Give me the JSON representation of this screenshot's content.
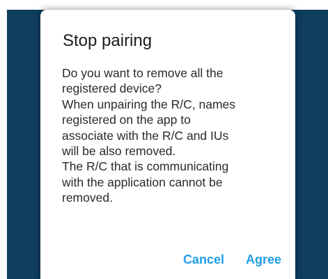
{
  "dialog": {
    "title": "Stop pairing",
    "body_lines": [
      "Do you want to remove all the",
      "registered device?",
      "When unpairing the R/C, names",
      "registered on the app to",
      "associate with the R/C and IUs",
      "will be also removed.",
      "The R/C that is communicating",
      "with the application cannot be",
      "removed."
    ],
    "cancel_label": "Cancel",
    "agree_label": "Agree"
  },
  "colors": {
    "backdrop": "#0f3e5e",
    "accent": "#1f9ee6",
    "dialog_background": "#ffffff"
  }
}
